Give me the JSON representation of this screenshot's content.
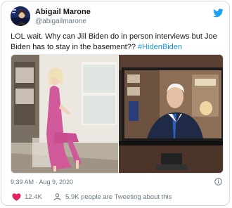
{
  "tweet": {
    "display_name": "Abigail Marone",
    "handle": "@abigailmarone",
    "text_main": "LOL wait. Why can Jill Biden do in person interviews but Joe Biden has to stay in the basement?? ",
    "hashtag": "#HidenBiden",
    "timestamp": "9:39 AM · Aug 9, 2020",
    "likes": "12.4K",
    "tweeting_about": "5.9K people are Tweeting about this"
  },
  "colors": {
    "accent": "#1da1f2",
    "hashtag": "#1b95e0",
    "muted": "#657786",
    "like_red": "#e0245e"
  },
  "icons": [
    "twitter-bird-icon",
    "info-icon",
    "heart-icon",
    "people-icon"
  ]
}
